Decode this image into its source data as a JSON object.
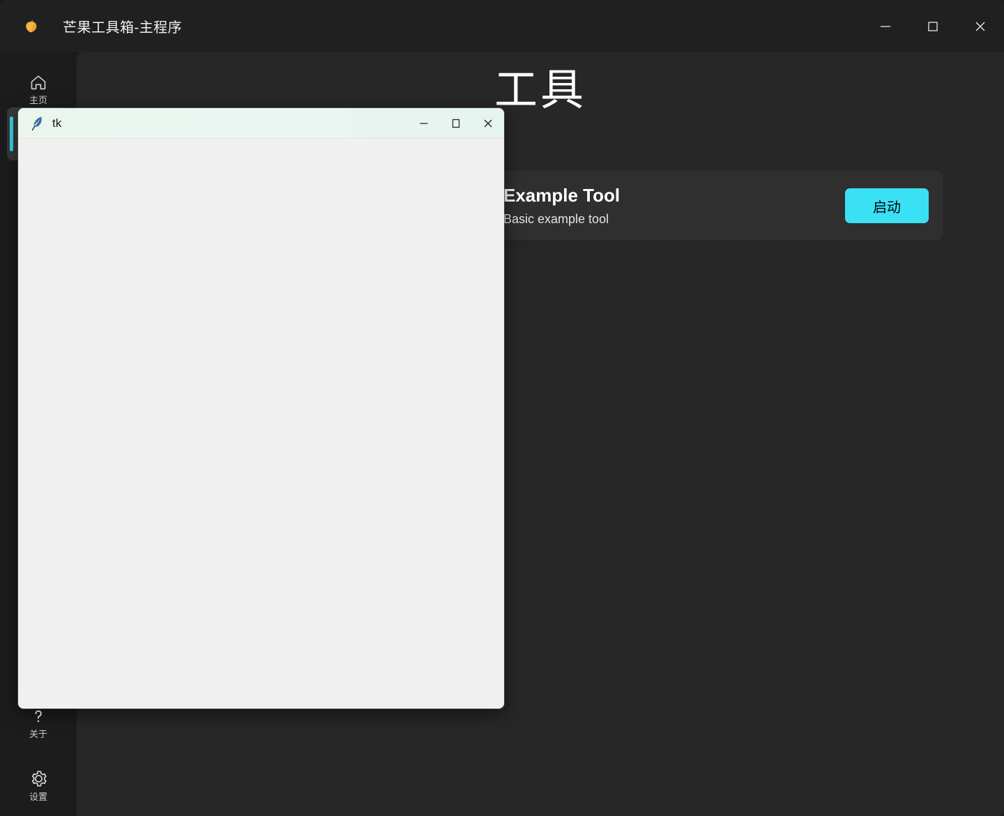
{
  "window": {
    "title": "芒果工具箱-主程序",
    "icon": "mango-icon",
    "controls": {
      "minimize": "minimize-icon",
      "maximize": "maximize-icon",
      "close": "close-icon"
    }
  },
  "sidebar": {
    "items": [
      {
        "id": "home",
        "label": "主页",
        "icon": "home-icon",
        "selected": false
      },
      {
        "id": "tools",
        "label": "",
        "icon": "tools-icon",
        "selected": true
      }
    ],
    "bottom_items": [
      {
        "id": "about",
        "label": "关于",
        "icon": "question-mark-icon",
        "selected": false
      },
      {
        "id": "settings",
        "label": "设置",
        "icon": "gear-icon",
        "selected": false
      }
    ],
    "accent_color": "#3ad6ee"
  },
  "main": {
    "page_title": "工具",
    "cards": [
      {
        "name": "Example Tool",
        "description": "Basic example tool",
        "button_label": "启动",
        "button_color": "#3ae1f5"
      }
    ]
  },
  "tk_window": {
    "title": "tk",
    "icon": "feather-icon",
    "controls": {
      "minimize": "minimize-icon",
      "maximize": "maximize-icon",
      "close": "close-icon"
    },
    "body_color": "#f0f0f0",
    "titlebar_color": "#e9f5ef"
  },
  "theme": {
    "titlebar_bg": "#202020",
    "sidebar_bg": "#1c1c1c",
    "content_bg": "#272727",
    "card_bg": "#2f2f2f",
    "accent": "#3ae1f5"
  }
}
